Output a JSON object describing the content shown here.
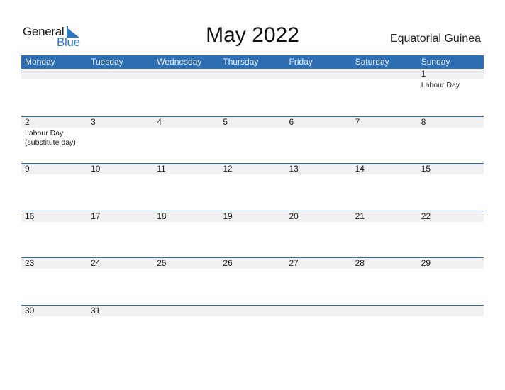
{
  "logo": {
    "general": "General",
    "blue": "Blue",
    "icon": "flag-triangle-icon"
  },
  "title": "May 2022",
  "country": "Equatorial Guinea",
  "colors": {
    "accent": "#2e6fb4",
    "strip": "#f1f1f1",
    "logo_blue": "#2b78c2"
  },
  "weekdays": [
    "Monday",
    "Tuesday",
    "Wednesday",
    "Thursday",
    "Friday",
    "Saturday",
    "Sunday"
  ],
  "weeks": [
    {
      "days": [
        {
          "num": "",
          "holiday": ""
        },
        {
          "num": "",
          "holiday": ""
        },
        {
          "num": "",
          "holiday": ""
        },
        {
          "num": "",
          "holiday": ""
        },
        {
          "num": "",
          "holiday": ""
        },
        {
          "num": "",
          "holiday": ""
        },
        {
          "num": "1",
          "holiday": "Labour Day"
        }
      ]
    },
    {
      "days": [
        {
          "num": "2",
          "holiday": "Labour Day (substitute day)"
        },
        {
          "num": "3",
          "holiday": ""
        },
        {
          "num": "4",
          "holiday": ""
        },
        {
          "num": "5",
          "holiday": ""
        },
        {
          "num": "6",
          "holiday": ""
        },
        {
          "num": "7",
          "holiday": ""
        },
        {
          "num": "8",
          "holiday": ""
        }
      ]
    },
    {
      "days": [
        {
          "num": "9",
          "holiday": ""
        },
        {
          "num": "10",
          "holiday": ""
        },
        {
          "num": "11",
          "holiday": ""
        },
        {
          "num": "12",
          "holiday": ""
        },
        {
          "num": "13",
          "holiday": ""
        },
        {
          "num": "14",
          "holiday": ""
        },
        {
          "num": "15",
          "holiday": ""
        }
      ]
    },
    {
      "days": [
        {
          "num": "16",
          "holiday": ""
        },
        {
          "num": "17",
          "holiday": ""
        },
        {
          "num": "18",
          "holiday": ""
        },
        {
          "num": "19",
          "holiday": ""
        },
        {
          "num": "20",
          "holiday": ""
        },
        {
          "num": "21",
          "holiday": ""
        },
        {
          "num": "22",
          "holiday": ""
        }
      ]
    },
    {
      "days": [
        {
          "num": "23",
          "holiday": ""
        },
        {
          "num": "24",
          "holiday": ""
        },
        {
          "num": "25",
          "holiday": ""
        },
        {
          "num": "26",
          "holiday": ""
        },
        {
          "num": "27",
          "holiday": ""
        },
        {
          "num": "28",
          "holiday": ""
        },
        {
          "num": "29",
          "holiday": ""
        }
      ]
    },
    {
      "days": [
        {
          "num": "30",
          "holiday": ""
        },
        {
          "num": "31",
          "holiday": ""
        },
        {
          "num": "",
          "holiday": ""
        },
        {
          "num": "",
          "holiday": ""
        },
        {
          "num": "",
          "holiday": ""
        },
        {
          "num": "",
          "holiday": ""
        },
        {
          "num": "",
          "holiday": ""
        }
      ]
    }
  ]
}
